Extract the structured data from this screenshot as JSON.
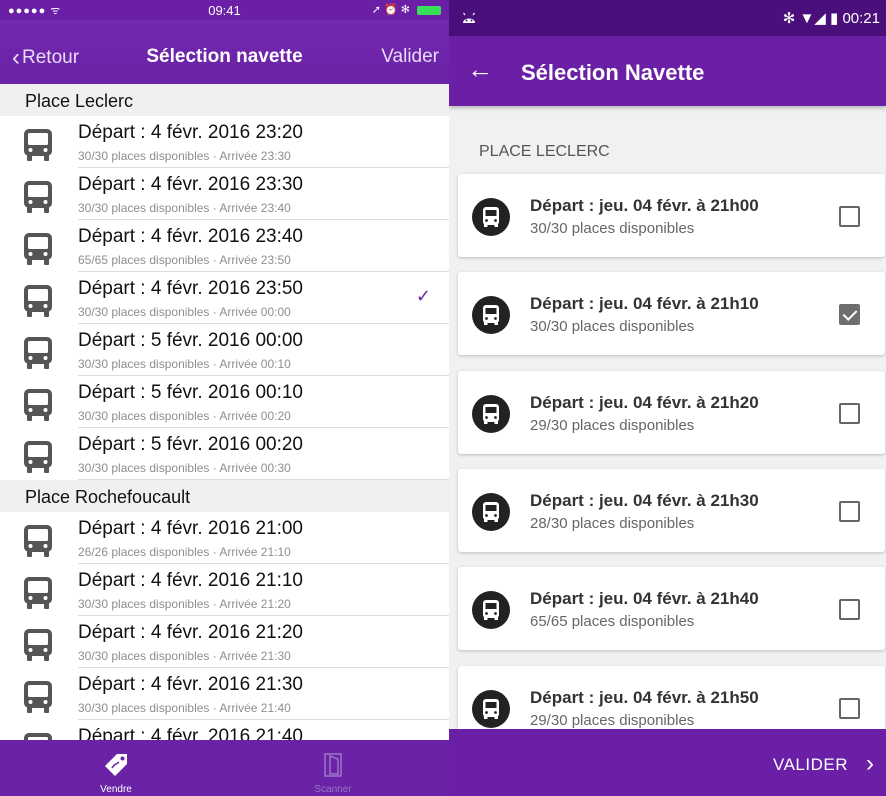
{
  "ios": {
    "status": {
      "signal": "●●●●● ᯤ",
      "time": "09:41",
      "icons": "➚ ⏰ ✻"
    },
    "nav": {
      "back_label": "Retour",
      "title": "Sélection navette",
      "validate_label": "Valider"
    },
    "sections": [
      {
        "title": "Place Leclerc",
        "rows": [
          {
            "main": "Départ : 4 févr. 2016 23:20",
            "sub": "30/30 places disponibles · Arrivée 23:30",
            "selected": false
          },
          {
            "main": "Départ : 4 févr. 2016 23:30",
            "sub": "30/30 places disponibles · Arrivée 23:40",
            "selected": false
          },
          {
            "main": "Départ : 4 févr. 2016 23:40",
            "sub": "65/65 places disponibles · Arrivée 23:50",
            "selected": false
          },
          {
            "main": "Départ : 4 févr. 2016 23:50",
            "sub": "30/30 places disponibles · Arrivée 00:00",
            "selected": true
          },
          {
            "main": "Départ : 5 févr. 2016 00:00",
            "sub": "30/30 places disponibles · Arrivée 00:10",
            "selected": false
          },
          {
            "main": "Départ : 5 févr. 2016 00:10",
            "sub": "30/30 places disponibles · Arrivée 00:20",
            "selected": false
          },
          {
            "main": "Départ : 5 févr. 2016 00:20",
            "sub": "30/30 places disponibles · Arrivée 00:30",
            "selected": false
          }
        ]
      },
      {
        "title": "Place Rochefoucault",
        "rows": [
          {
            "main": "Départ : 4 févr. 2016 21:00",
            "sub": "26/26 places disponibles · Arrivée 21:10",
            "selected": false
          },
          {
            "main": "Départ : 4 févr. 2016 21:10",
            "sub": "30/30 places disponibles · Arrivée 21:20",
            "selected": false
          },
          {
            "main": "Départ : 4 févr. 2016 21:20",
            "sub": "30/30 places disponibles · Arrivée 21:30",
            "selected": false
          },
          {
            "main": "Départ : 4 févr. 2016 21:30",
            "sub": "30/30 places disponibles · Arrivée 21:40",
            "selected": false
          },
          {
            "main": "Départ : 4 févr. 2016 21:40",
            "sub": "",
            "selected": false
          }
        ]
      }
    ],
    "tabs": [
      {
        "label": "Vendre",
        "icon": "tag-icon",
        "active": true
      },
      {
        "label": "Scanner",
        "icon": "door-icon",
        "active": false
      }
    ],
    "colors": {
      "accent": "#6a22a6",
      "check": "#6a22a6"
    }
  },
  "android": {
    "status": {
      "icons": "✻ ▼◢",
      "time": "00:21"
    },
    "appbar": {
      "title": "Sélection Navette"
    },
    "section_title": "PLACE LECLERC",
    "cards": [
      {
        "main": "Départ : jeu. 04 févr. à 21h00",
        "sub": "30/30 places disponibles",
        "checked": false
      },
      {
        "main": "Départ : jeu. 04 févr. à 21h10",
        "sub": "30/30 places disponibles",
        "checked": true
      },
      {
        "main": "Départ : jeu. 04 févr. à 21h20",
        "sub": "29/30 places disponibles",
        "checked": false
      },
      {
        "main": "Départ : jeu. 04 févr. à 21h30",
        "sub": "28/30 places disponibles",
        "checked": false
      },
      {
        "main": "Départ : jeu. 04 févr. à 21h40",
        "sub": "65/65 places disponibles",
        "checked": false
      },
      {
        "main": "Départ : jeu. 04 févr. à 21h50",
        "sub": "29/30 places disponibles",
        "checked": false
      }
    ],
    "bottom": {
      "validate_label": "VALIDER",
      "next_icon": "chevron-right-icon"
    },
    "colors": {
      "primary": "#6a1fa6",
      "status": "#4a0f7a"
    }
  }
}
